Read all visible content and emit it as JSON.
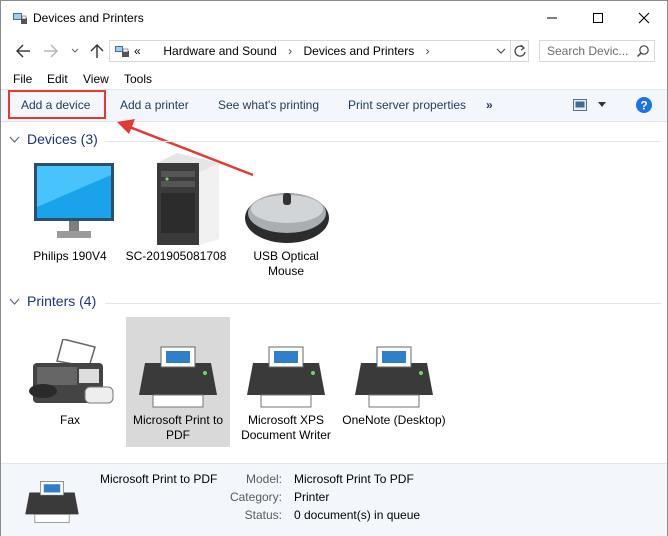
{
  "window": {
    "title": "Devices and Printers"
  },
  "address": {
    "overflow": "«",
    "crumbs": [
      "Hardware and Sound",
      "Devices and Printers"
    ]
  },
  "search": {
    "placeholder": "Search Devic..."
  },
  "menu": [
    "File",
    "Edit",
    "View",
    "Tools"
  ],
  "commands": [
    "Add a device",
    "Add a printer",
    "See what's printing",
    "Print server properties",
    "»"
  ],
  "groups": {
    "devices": {
      "title": "Devices (3)",
      "items": [
        "Philips 190V4",
        "SC-201905081708",
        "USB Optical Mouse"
      ]
    },
    "printers": {
      "title": "Printers (4)",
      "items": [
        "Fax",
        "Microsoft Print to PDF",
        "Microsoft XPS Document Writer",
        "OneNote (Desktop)"
      ]
    }
  },
  "details": {
    "name": "Microsoft Print to PDF",
    "rows": [
      {
        "key": "Model:",
        "value": "Microsoft Print To PDF"
      },
      {
        "key": "Category:",
        "value": "Printer"
      },
      {
        "key": "Status:",
        "value": "0 document(s) in queue"
      }
    ]
  },
  "colors": {
    "accent": "#1e3287",
    "highlight": "#e53935",
    "selected": "#d9d9d9",
    "help": "#1a73e8"
  }
}
